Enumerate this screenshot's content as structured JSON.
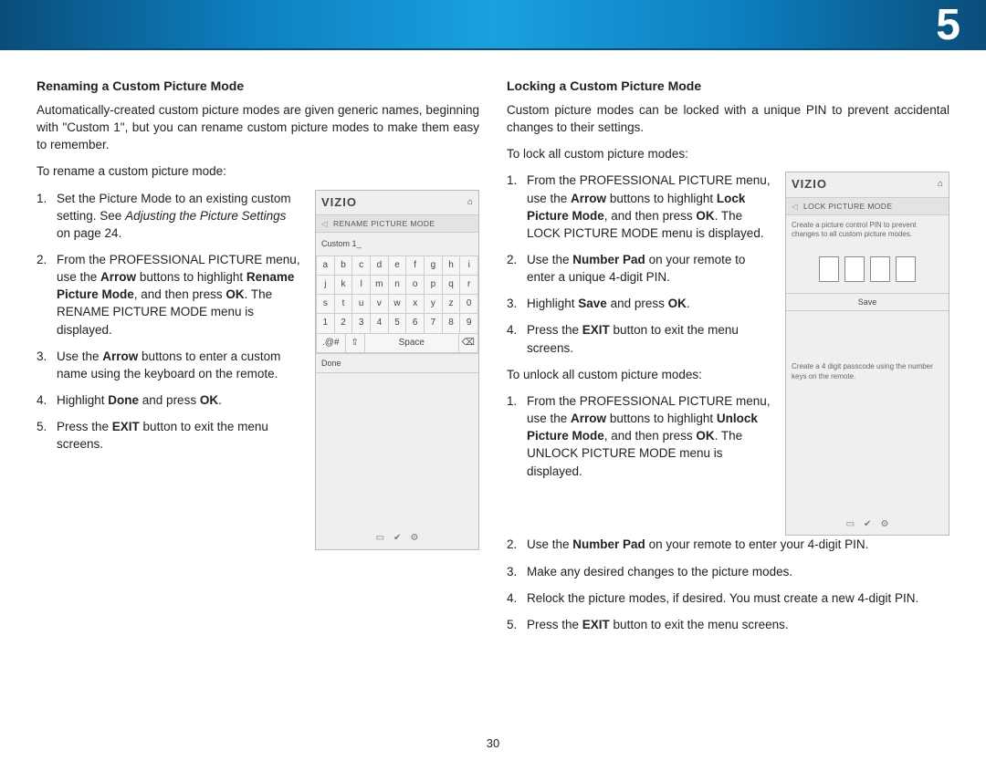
{
  "chapter": "5",
  "page_number": "30",
  "left": {
    "heading": "Renaming a Custom Picture Mode",
    "intro": "Automatically-created custom picture modes are given generic names, beginning with \"Custom 1\", but you can rename custom picture modes to make them easy to remember.",
    "lead": "To rename a custom picture mode:",
    "steps": {
      "s1a": "Set the Picture Mode to an existing custom setting. See ",
      "s1b": "Adjusting the Picture Settings",
      "s1c": " on page 24.",
      "s2a": "From the PROFESSIONAL PICTURE menu, use the ",
      "s2b": "Arrow",
      "s2c": " buttons to highlight ",
      "s2d": "Rename Picture Mode",
      "s2e": ", and then press ",
      "s2f": "OK",
      "s2g": ". The RENAME PICTURE MODE menu is displayed.",
      "s3a": "Use the ",
      "s3b": "Arrow",
      "s3c": " buttons to enter a custom name using the keyboard on the remote.",
      "s4a": "Highlight ",
      "s4b": "Done",
      "s4c": " and press ",
      "s4d": "OK",
      "s4e": ".",
      "s5a": "Press the ",
      "s5b": "EXIT",
      "s5c": " button to exit the menu screens."
    },
    "screen": {
      "brand": "VIZIO",
      "crumb": "RENAME PICTURE MODE",
      "input": "Custom 1_",
      "rows": {
        "r1": [
          "a",
          "b",
          "c",
          "d",
          "e",
          "f",
          "g",
          "h",
          "i"
        ],
        "r2": [
          "j",
          "k",
          "l",
          "m",
          "n",
          "o",
          "p",
          "q",
          "r"
        ],
        "r3": [
          "s",
          "t",
          "u",
          "v",
          "w",
          "x",
          "y",
          "z",
          "0"
        ],
        "r4": [
          "1",
          "2",
          "3",
          "4",
          "5",
          "6",
          "7",
          "8",
          "9"
        ],
        "sp": [
          ".@#",
          "⇧",
          "Space",
          "⌫"
        ]
      },
      "done": "Done",
      "foot": [
        "▭",
        "✔",
        "⚙"
      ]
    }
  },
  "right": {
    "heading": "Locking a Custom Picture Mode",
    "intro": "Custom picture modes can be locked with a unique PIN to prevent accidental changes to their settings.",
    "lead1": "To lock all custom picture modes:",
    "lock": {
      "s1a": "From the PROFESSIONAL PICTURE menu, use the ",
      "s1b": "Arrow",
      "s1c": " buttons to highlight ",
      "s1d": "Lock Picture Mode",
      "s1e": ", and then press ",
      "s1f": "OK",
      "s1g": ". The LOCK PICTURE MODE menu is displayed.",
      "s2a": "Use the ",
      "s2b": "Number Pad",
      "s2c": " on your remote to enter a unique 4-digit PIN.",
      "s3a": "Highlight ",
      "s3b": "Save",
      "s3c": " and press ",
      "s3d": "OK",
      "s3e": ".",
      "s4a": "Press the ",
      "s4b": "EXIT",
      "s4c": " button to exit the menu screens."
    },
    "lead2": "To unlock all custom picture modes:",
    "unlock": {
      "s1a": "From the PROFESSIONAL PICTURE menu, use the ",
      "s1b": "Arrow",
      "s1c": " buttons to highlight ",
      "s1d": "Unlock Picture Mode",
      "s1e": ", and then press ",
      "s1f": "OK",
      "s1g": ". The UNLOCK PICTURE MODE menu is displayed.",
      "s2a": "Use the ",
      "s2b": "Number Pad",
      "s2c": " on your remote to enter your 4-digit PIN.",
      "s3": "Make any desired changes to the picture modes.",
      "s4": "Relock the picture modes, if desired. You must create a new 4-digit PIN.",
      "s5a": "Press the ",
      "s5b": "EXIT",
      "s5c": " button to exit the menu screens."
    },
    "screen": {
      "brand": "VIZIO",
      "crumb": "LOCK PICTURE MODE",
      "hint1": "Create a picture control PIN to prevent changes to all custom picture modes.",
      "save": "Save",
      "hint2": "Create a 4 digit passcode using the number keys on the remote.",
      "foot": [
        "▭",
        "✔",
        "⚙"
      ]
    }
  }
}
